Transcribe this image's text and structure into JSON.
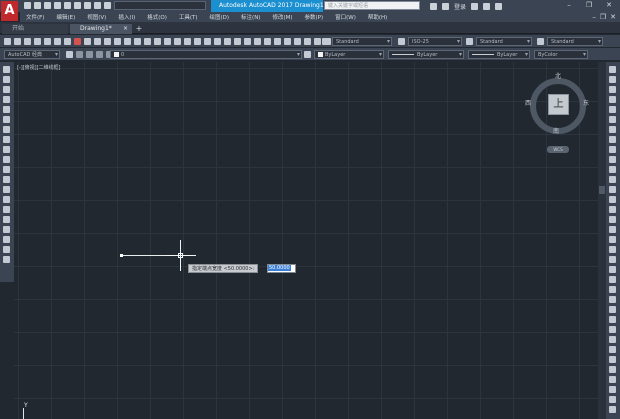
{
  "app": {
    "logo_letter": "A",
    "title": "Autodesk AutoCAD 2017    Drawing1.dwg",
    "search_placeholder": "键入关键字或短语",
    "login_label": "登录"
  },
  "menu": {
    "items": [
      "文件(F)",
      "编辑(E)",
      "视图(V)",
      "插入(I)",
      "格式(O)",
      "工具(T)",
      "绘图(D)",
      "标注(N)",
      "修改(M)",
      "参数(P)",
      "窗口(W)",
      "帮助(H)"
    ]
  },
  "tabs": {
    "start": "开始",
    "drawing": "Drawing1*",
    "close_symbol": "×",
    "new_symbol": "+"
  },
  "toolbar1": {
    "text_style": "Standard",
    "dim_style": "ISO-25",
    "table_style": "Standard",
    "multileader_style": "Standard"
  },
  "toolbar2": {
    "workspace": "AutoCAD 经典",
    "layer": "0",
    "color": "ByLayer",
    "linetype": "ByLayer",
    "lineweight": "ByLayer",
    "plotstyle": "ByColor"
  },
  "canvas": {
    "viewport_label": "[-][俯视][二维线框]",
    "prompt_text": "指定端点宽度 <50.0000>:",
    "input_value": "50.0000",
    "ucs_y": "Y"
  },
  "viewcube": {
    "north": "北",
    "south": "南",
    "west": "西",
    "east": "东",
    "face_label": "上",
    "wcs_label": "WCS"
  },
  "colors": {
    "canvas_bg": "#212830",
    "active_title": "#1b8fd0",
    "logo_red": "#c0282b",
    "selection_blue": "#3d7fd6"
  }
}
